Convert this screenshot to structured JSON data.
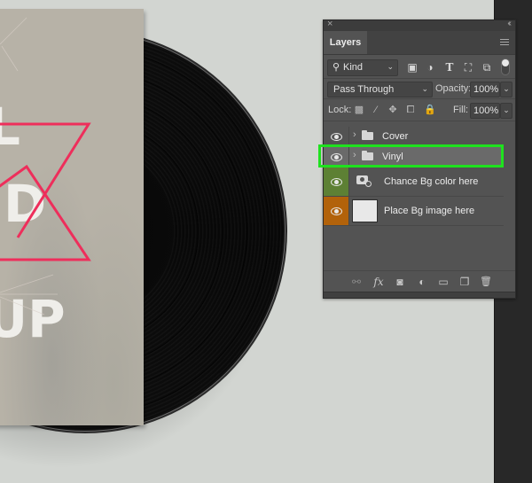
{
  "canvas": {
    "artwork_description": "Vinyl record mockup with sleeve",
    "cover_letters": [
      "L",
      "D",
      "UP"
    ],
    "cover_accent_color": "#ee2e5b",
    "background_color": "#d2d5d1"
  },
  "panel": {
    "close_glyph": "×",
    "collapse_glyph": "‹‹",
    "tab_label": "Layers",
    "kind_filter": {
      "icon": "search-icon",
      "value": "Kind"
    },
    "filter_icons": [
      "image-filter-icon",
      "adjustment-filter-icon",
      "type-filter-icon",
      "shape-filter-icon",
      "smart-object-filter-icon"
    ],
    "blend_mode": "Pass Through",
    "opacity_label": "Opacity:",
    "opacity_value": "100%",
    "lock_label": "Lock:",
    "lock_icons": [
      "lock-transparent-icon",
      "lock-image-icon",
      "lock-position-icon",
      "lock-artboard-icon",
      "lock-all-icon"
    ],
    "fill_label": "Fill:",
    "fill_value": "100%",
    "layers": [
      {
        "name": "Cover",
        "type": "group",
        "visible": true,
        "selected": false,
        "eye_color": ""
      },
      {
        "name": "Vinyl",
        "type": "group",
        "visible": true,
        "selected": true,
        "eye_color": ""
      },
      {
        "name": "Chance Bg color here",
        "type": "smart-object",
        "visible": true,
        "selected": false,
        "eye_color": "#5d8034"
      },
      {
        "name": "Place Bg image here",
        "type": "image",
        "visible": true,
        "selected": false,
        "eye_color": "#b2620a"
      }
    ],
    "footer_icons": [
      "link-layers-icon",
      "fx-icon",
      "layer-mask-icon",
      "adjustment-layer-icon",
      "new-group-icon",
      "new-layer-icon",
      "trash-icon"
    ],
    "footer_glyphs": [
      "⚯",
      "fx",
      "◙",
      "◐",
      "▭",
      "❐",
      "🗑"
    ]
  },
  "highlight": {
    "color": "#1ee21e",
    "target": "Vinyl"
  }
}
